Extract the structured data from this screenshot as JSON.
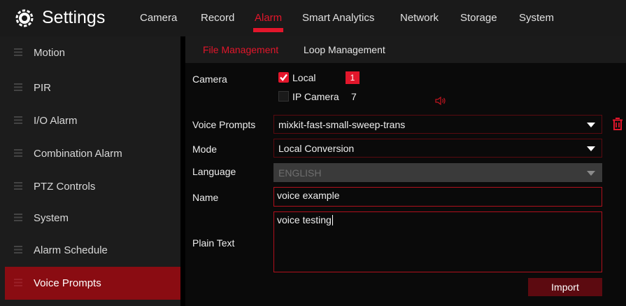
{
  "header": {
    "title": "Settings",
    "tabs": [
      {
        "label": "Camera",
        "active": false
      },
      {
        "label": "Record",
        "active": false
      },
      {
        "label": "Alarm",
        "active": true
      },
      {
        "label": "Smart Analytics",
        "active": false
      },
      {
        "label": "Network",
        "active": false
      },
      {
        "label": "Storage",
        "active": false
      },
      {
        "label": "System",
        "active": false
      }
    ]
  },
  "sidebar": {
    "items": [
      {
        "label": "Motion"
      },
      {
        "label": "PIR"
      },
      {
        "label": "I/O Alarm"
      },
      {
        "label": "Combination Alarm"
      },
      {
        "label": "PTZ Controls"
      },
      {
        "label": "System"
      },
      {
        "label": "Alarm Schedule"
      },
      {
        "label": "Voice Prompts",
        "active": true
      }
    ]
  },
  "subtabs": [
    {
      "label": "File Management",
      "active": true
    },
    {
      "label": "Loop Management",
      "active": false
    }
  ],
  "form": {
    "camera": {
      "label": "Camera",
      "local_label": "Local",
      "local_checked": true,
      "local_count": "1",
      "ip_label": "IP Camera",
      "ip_checked": false,
      "ip_count": "7"
    },
    "voice_prompts": {
      "label": "Voice Prompts",
      "value": "mixkit-fast-small-sweep-trans"
    },
    "mode": {
      "label": "Mode",
      "value": "Local Conversion"
    },
    "language": {
      "label": "Language",
      "value": "ENGLISH",
      "disabled": true
    },
    "name": {
      "label": "Name",
      "value": "voice example"
    },
    "plain_text": {
      "label": "Plain Text",
      "value": "voice testing"
    },
    "import_label": "Import"
  },
  "colors": {
    "accent": "#e2162b",
    "active_sidebar": "#8a0c12",
    "button": "#5c0a10"
  }
}
